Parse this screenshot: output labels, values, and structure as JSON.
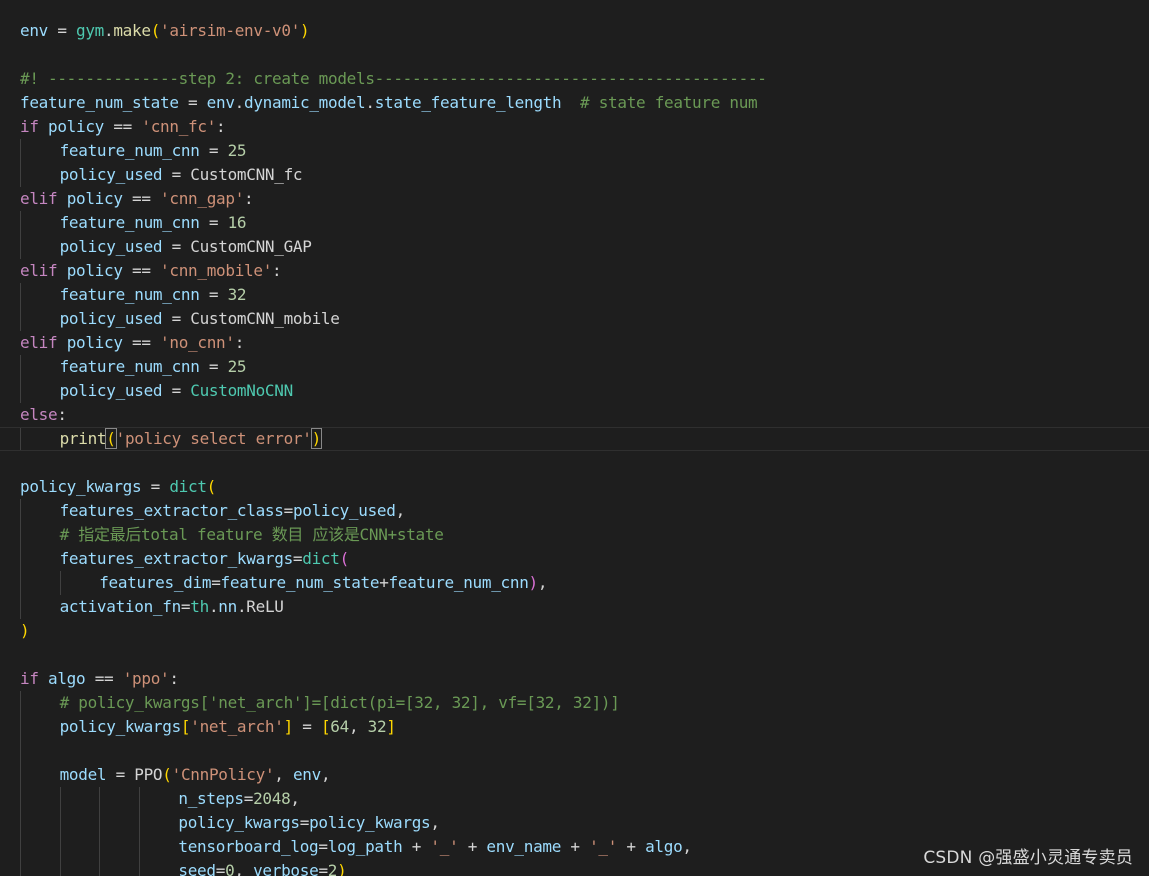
{
  "editor": {
    "lines": [
      {
        "indent": 0,
        "tokens": [
          [
            "var",
            "env"
          ],
          [
            "op",
            " = "
          ],
          [
            "cls",
            "gym"
          ],
          [
            "op",
            "."
          ],
          [
            "fn",
            "make"
          ],
          [
            "b1",
            "("
          ],
          [
            "str",
            "'airsim-env-v0'"
          ],
          [
            "b1",
            ")"
          ]
        ]
      },
      {
        "indent": 0,
        "tokens": []
      },
      {
        "indent": 0,
        "tokens": [
          [
            "com",
            "#! --------------step 2: create models------------------------------------------"
          ]
        ]
      },
      {
        "indent": 0,
        "tokens": [
          [
            "var",
            "feature_num_state"
          ],
          [
            "op",
            " = "
          ],
          [
            "var",
            "env"
          ],
          [
            "op",
            "."
          ],
          [
            "var",
            "dynamic_model"
          ],
          [
            "op",
            "."
          ],
          [
            "var",
            "state_feature_length"
          ],
          [
            "op",
            "  "
          ],
          [
            "com",
            "# state feature num"
          ]
        ]
      },
      {
        "indent": 0,
        "tokens": [
          [
            "kw",
            "if"
          ],
          [
            "op",
            " "
          ],
          [
            "var",
            "policy"
          ],
          [
            "op",
            " == "
          ],
          [
            "str",
            "'cnn_fc'"
          ],
          [
            "op",
            ":"
          ]
        ]
      },
      {
        "indent": 1,
        "tokens": [
          [
            "var",
            "feature_num_cnn"
          ],
          [
            "op",
            " = "
          ],
          [
            "num",
            "25"
          ]
        ]
      },
      {
        "indent": 1,
        "tokens": [
          [
            "var",
            "policy_used"
          ],
          [
            "op",
            " = "
          ],
          [
            "plain",
            "CustomCNN_fc"
          ]
        ]
      },
      {
        "indent": 0,
        "tokens": [
          [
            "kw",
            "elif"
          ],
          [
            "op",
            " "
          ],
          [
            "var",
            "policy"
          ],
          [
            "op",
            " == "
          ],
          [
            "str",
            "'cnn_gap'"
          ],
          [
            "op",
            ":"
          ]
        ]
      },
      {
        "indent": 1,
        "tokens": [
          [
            "var",
            "feature_num_cnn"
          ],
          [
            "op",
            " = "
          ],
          [
            "num",
            "16"
          ]
        ]
      },
      {
        "indent": 1,
        "tokens": [
          [
            "var",
            "policy_used"
          ],
          [
            "op",
            " = "
          ],
          [
            "plain",
            "CustomCNN_GAP"
          ]
        ]
      },
      {
        "indent": 0,
        "tokens": [
          [
            "kw",
            "elif"
          ],
          [
            "op",
            " "
          ],
          [
            "var",
            "policy"
          ],
          [
            "op",
            " == "
          ],
          [
            "str",
            "'cnn_mobile'"
          ],
          [
            "op",
            ":"
          ]
        ]
      },
      {
        "indent": 1,
        "tokens": [
          [
            "var",
            "feature_num_cnn"
          ],
          [
            "op",
            " = "
          ],
          [
            "num",
            "32"
          ]
        ]
      },
      {
        "indent": 1,
        "tokens": [
          [
            "var",
            "policy_used"
          ],
          [
            "op",
            " = "
          ],
          [
            "plain",
            "CustomCNN_mobile"
          ]
        ]
      },
      {
        "indent": 0,
        "tokens": [
          [
            "kw",
            "elif"
          ],
          [
            "op",
            " "
          ],
          [
            "var",
            "policy"
          ],
          [
            "op",
            " == "
          ],
          [
            "str",
            "'no_cnn'"
          ],
          [
            "op",
            ":"
          ]
        ]
      },
      {
        "indent": 1,
        "tokens": [
          [
            "var",
            "feature_num_cnn"
          ],
          [
            "op",
            " = "
          ],
          [
            "num",
            "25"
          ]
        ]
      },
      {
        "indent": 1,
        "tokens": [
          [
            "var",
            "policy_used"
          ],
          [
            "op",
            " = "
          ],
          [
            "cls",
            "CustomNoCNN"
          ]
        ]
      },
      {
        "indent": 0,
        "tokens": [
          [
            "kw",
            "else"
          ],
          [
            "op",
            ":"
          ]
        ]
      },
      {
        "indent": 1,
        "active": true,
        "tokens": [
          [
            "fn",
            "print"
          ],
          [
            "b1",
            "(",
            "match"
          ],
          [
            "str",
            "'policy select error'"
          ],
          [
            "b1",
            ")",
            "match"
          ]
        ]
      },
      {
        "indent": 0,
        "tokens": []
      },
      {
        "indent": 0,
        "tokens": [
          [
            "var",
            "policy_kwargs"
          ],
          [
            "op",
            " = "
          ],
          [
            "cls",
            "dict"
          ],
          [
            "b1",
            "("
          ]
        ]
      },
      {
        "indent": 1,
        "tokens": [
          [
            "var",
            "features_extractor_class"
          ],
          [
            "op",
            "="
          ],
          [
            "var",
            "policy_used"
          ],
          [
            "op",
            ","
          ]
        ]
      },
      {
        "indent": 1,
        "tokens": [
          [
            "com",
            "# 指定最后total feature 数目 应该是CNN+state"
          ]
        ]
      },
      {
        "indent": 1,
        "tokens": [
          [
            "var",
            "features_extractor_kwargs"
          ],
          [
            "op",
            "="
          ],
          [
            "cls",
            "dict"
          ],
          [
            "b2",
            "("
          ]
        ]
      },
      {
        "indent": 2,
        "tokens": [
          [
            "var",
            "features_dim"
          ],
          [
            "op",
            "="
          ],
          [
            "var",
            "feature_num_state"
          ],
          [
            "op",
            "+"
          ],
          [
            "var",
            "feature_num_cnn"
          ],
          [
            "b2",
            ")"
          ],
          [
            "op",
            ","
          ]
        ]
      },
      {
        "indent": 1,
        "tokens": [
          [
            "var",
            "activation_fn"
          ],
          [
            "op",
            "="
          ],
          [
            "cls",
            "th"
          ],
          [
            "op",
            "."
          ],
          [
            "var",
            "nn"
          ],
          [
            "op",
            "."
          ],
          [
            "plain",
            "ReLU"
          ]
        ]
      },
      {
        "indent": 0,
        "tokens": [
          [
            "b1",
            ")"
          ]
        ]
      },
      {
        "indent": 0,
        "tokens": []
      },
      {
        "indent": 0,
        "tokens": [
          [
            "kw",
            "if"
          ],
          [
            "op",
            " "
          ],
          [
            "var",
            "algo"
          ],
          [
            "op",
            " == "
          ],
          [
            "str",
            "'ppo'"
          ],
          [
            "op",
            ":"
          ]
        ]
      },
      {
        "indent": 1,
        "tokens": [
          [
            "com",
            "# policy_kwargs['net_arch']=[dict(pi=[32, 32], vf=[32, 32])]"
          ]
        ]
      },
      {
        "indent": 1,
        "tokens": [
          [
            "var",
            "policy_kwargs"
          ],
          [
            "b1",
            "["
          ],
          [
            "str",
            "'net_arch'"
          ],
          [
            "b1",
            "]"
          ],
          [
            "op",
            " = "
          ],
          [
            "b1",
            "["
          ],
          [
            "num",
            "64"
          ],
          [
            "op",
            ", "
          ],
          [
            "num",
            "32"
          ],
          [
            "b1",
            "]"
          ]
        ]
      },
      {
        "indent": 0,
        "guides": 1,
        "tokens": []
      },
      {
        "indent": 1,
        "tokens": [
          [
            "var",
            "model"
          ],
          [
            "op",
            " = "
          ],
          [
            "plain",
            "PPO"
          ],
          [
            "b1",
            "("
          ],
          [
            "str",
            "'CnnPolicy'"
          ],
          [
            "op",
            ", "
          ],
          [
            "var",
            "env"
          ],
          [
            "op",
            ","
          ]
        ]
      },
      {
        "indent": 4,
        "guides": 4,
        "tokens": [
          [
            "var",
            "n_steps"
          ],
          [
            "op",
            "="
          ],
          [
            "num",
            "2048"
          ],
          [
            "op",
            ","
          ]
        ]
      },
      {
        "indent": 4,
        "guides": 4,
        "tokens": [
          [
            "var",
            "policy_kwargs"
          ],
          [
            "op",
            "="
          ],
          [
            "var",
            "policy_kwargs"
          ],
          [
            "op",
            ","
          ]
        ]
      },
      {
        "indent": 4,
        "guides": 4,
        "tokens": [
          [
            "var",
            "tensorboard_log"
          ],
          [
            "op",
            "="
          ],
          [
            "var",
            "log_path"
          ],
          [
            "op",
            " + "
          ],
          [
            "str",
            "'_'"
          ],
          [
            "op",
            " + "
          ],
          [
            "var",
            "env_name"
          ],
          [
            "op",
            " + "
          ],
          [
            "str",
            "'_'"
          ],
          [
            "op",
            " + "
          ],
          [
            "var",
            "algo"
          ],
          [
            "op",
            ","
          ]
        ]
      },
      {
        "indent": 4,
        "guides": 4,
        "tokens": [
          [
            "var",
            "seed"
          ],
          [
            "op",
            "="
          ],
          [
            "num",
            "0"
          ],
          [
            "op",
            ", "
          ],
          [
            "var",
            "verbose"
          ],
          [
            "op",
            "="
          ],
          [
            "num",
            "2"
          ],
          [
            "b1",
            ")"
          ]
        ]
      }
    ]
  },
  "watermark": {
    "text": "CSDN @强盛小灵通专卖员"
  }
}
